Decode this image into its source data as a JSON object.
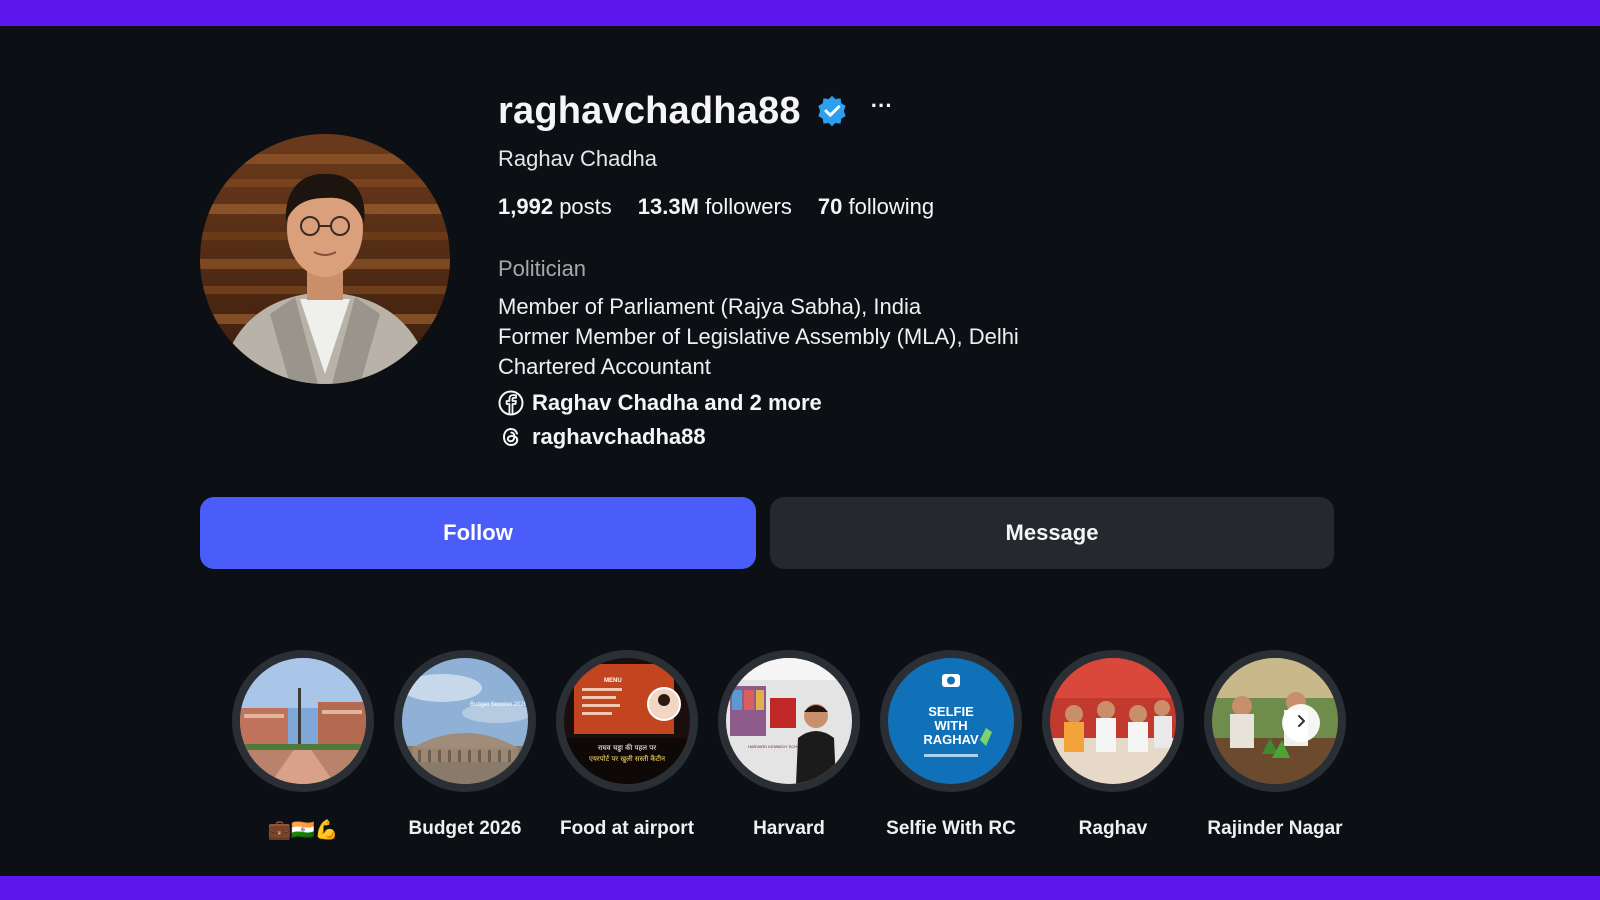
{
  "frame": {
    "accent_color": "#5b17ec"
  },
  "profile": {
    "username": "raghavchadha88",
    "verified_icon": "verified-badge-icon",
    "more_label": "···",
    "full_name": "Raghav Chadha",
    "stats": [
      {
        "value": "1,992",
        "label": "posts"
      },
      {
        "value": "13.3M",
        "label": "followers"
      },
      {
        "value": "70",
        "label": "following"
      }
    ],
    "category": "Politician",
    "bio_lines": [
      "Member of Parliament (Rajya Sabha), India",
      "Former Member of Legislative Assembly (MLA), Delhi",
      "Chartered Accountant"
    ],
    "facebook_link": "Raghav Chadha and 2 more",
    "threads_link": "raghavchadha88"
  },
  "actions": {
    "follow_label": "Follow",
    "message_label": "Message",
    "follow_color": "#4a5df9"
  },
  "highlights": [
    {
      "label": "💼🇮🇳💪"
    },
    {
      "label": "Budget 2026"
    },
    {
      "label": "Food at airport"
    },
    {
      "label": "Harvard"
    },
    {
      "label": "Selfie With RC"
    },
    {
      "label": "Raghav"
    },
    {
      "label": "Rajinder Nagar"
    }
  ],
  "highlight_texts": {
    "budget_session": "Budget Session 2026",
    "food_line1": "राघव चड्ढा की पहल पर",
    "food_line2": "एयरपोर्ट पर खुली सस्ती कैंटीन",
    "food_menu": "MENU",
    "harvard_sign": "HARVARD KENNEDY SCHOOL",
    "selfie_line1": "SELFIE",
    "selfie_line2": "WITH",
    "selfie_line3": "RAGHAV"
  }
}
